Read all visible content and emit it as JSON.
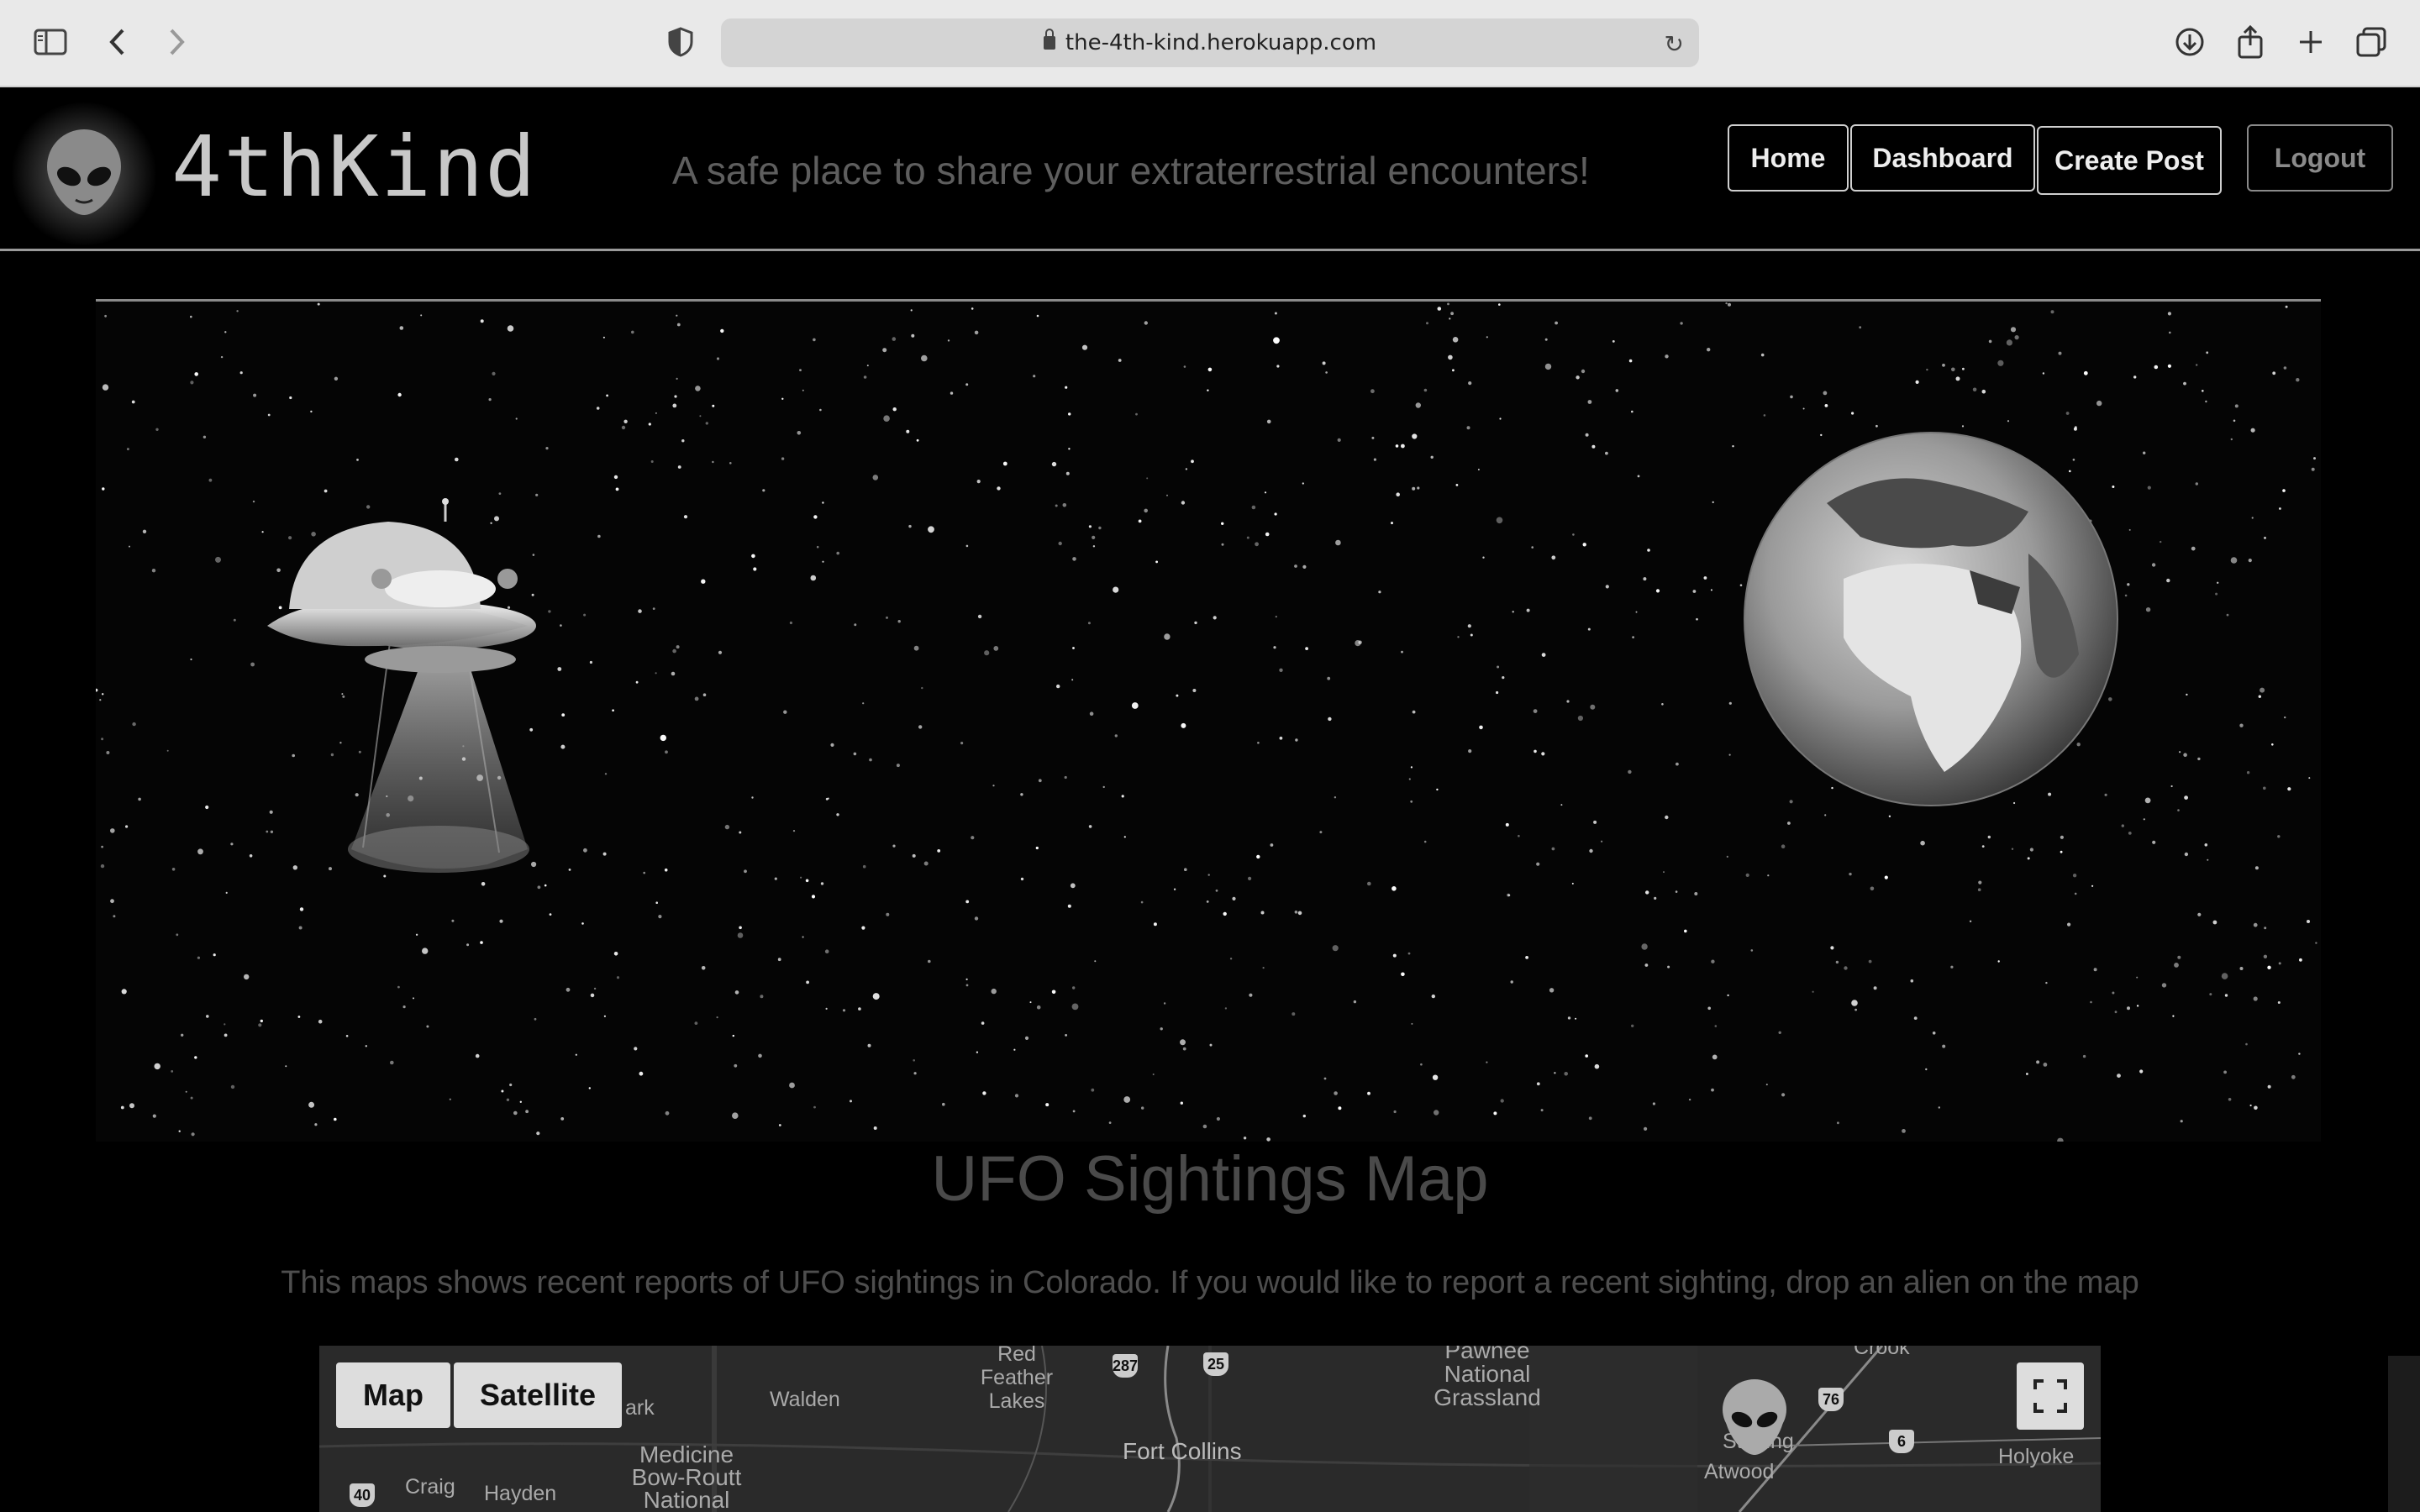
{
  "browser": {
    "url": "the-4th-kind.herokuapp.com"
  },
  "header": {
    "brand": "4thKind",
    "tagline": "A safe place to share your extraterrestrial encounters!",
    "nav": [
      {
        "label": "Home"
      },
      {
        "label": "Dashboard"
      },
      {
        "label": "Create Post"
      },
      {
        "label": "Logout"
      }
    ]
  },
  "map_section": {
    "title": "UFO Sightings Map",
    "description": "This maps shows recent reports of UFO sightings in Colorado. If you would like to report a recent sighting, drop an alien on the map",
    "map_type_buttons": [
      "Map",
      "Satellite"
    ],
    "places": [
      "Red Feather Lakes",
      "Walden",
      "Medicine Bow-Routt National",
      "Fort Collins",
      "Pawnee National Grassland",
      "Crook",
      "Sterling",
      "Atwood",
      "Holyoke",
      "Craig",
      "Hayden",
      "ark"
    ],
    "highways": [
      "287",
      "25",
      "76",
      "6",
      "40"
    ]
  }
}
